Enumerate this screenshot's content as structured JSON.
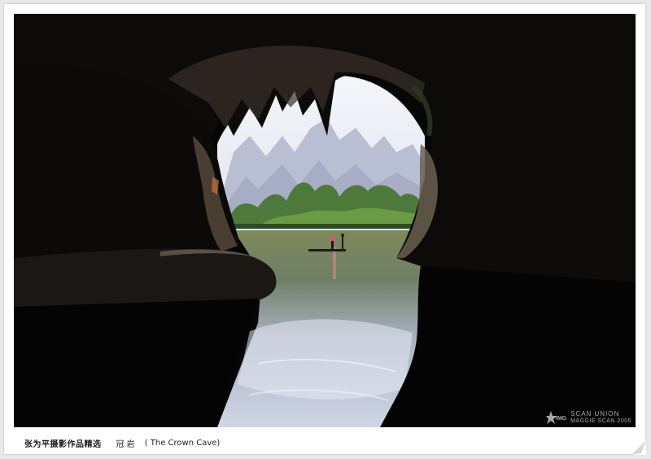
{
  "footer": {
    "series": "张为平摄影作品精选",
    "title_cn": "冠 岩",
    "title_en": "( The Crown Cave)"
  },
  "watermark": {
    "logo_text": "IMG",
    "line1": "SCAN UNION",
    "line2": "MAGGIE SCAN 2005"
  }
}
